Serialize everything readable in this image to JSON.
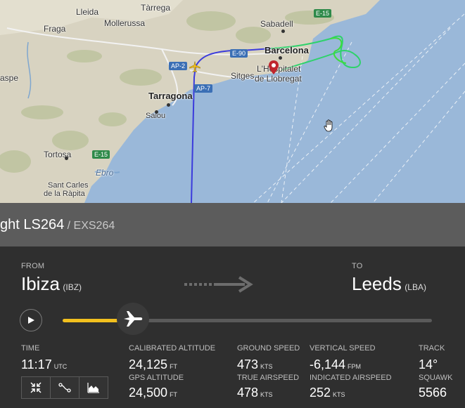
{
  "map": {
    "cities": {
      "lleida": "Lleida",
      "tarrega": "Tàrrega",
      "mollerussa": "Mollerussa",
      "fraga": "Fraga",
      "sabadell": "Sabadell",
      "barcelona": "Barcelona",
      "lhospitalet_1": "L'Hospitalet",
      "lhospitalet_2": "de Llobregat",
      "sitges": "Sitges",
      "tarragona": "Tarragona",
      "salou": "Salou",
      "tortosa": "Tortosa",
      "ebro": "Ebro",
      "santcarles_1": "Sant Carles",
      "santcarles_2": "de la Ràpita",
      "caspe": "aspe"
    },
    "roads": {
      "e15_top": "E-15",
      "e15_left": "E-15",
      "e90": "E-90",
      "ap2": "AP-2",
      "ap7": "AP-7"
    }
  },
  "flight": {
    "title_main": "ght LS264",
    "title_sub": " / EXS264"
  },
  "route": {
    "from_label": "FROM",
    "from_city": "Ibiza",
    "from_code": "(IBZ)",
    "to_label": "TO",
    "to_city": "Leeds",
    "to_code": "(LBA)",
    "progress": 0.19
  },
  "stats": {
    "time_label": "TIME",
    "time_value": "11:17",
    "time_unit": "UTC",
    "cal_alt_label": "CALIBRATED ALTITUDE",
    "cal_alt_value": "24,125",
    "cal_alt_unit": "FT",
    "gps_alt_label": "GPS ALTITUDE",
    "gps_alt_value": "24,500",
    "gps_alt_unit": "FT",
    "gs_label": "GROUND SPEED",
    "gs_value": "473",
    "gs_unit": "KTS",
    "tas_label": "TRUE AIRSPEED",
    "tas_value": "478",
    "tas_unit": "KTS",
    "vs_label": "VERTICAL SPEED",
    "vs_value": "-6,144",
    "vs_unit": "FPM",
    "ias_label": "INDICATED AIRSPEED",
    "ias_value": "252",
    "ias_unit": "KTS",
    "track_label": "TRACK",
    "track_value": "14°",
    "squawk_label": "SQUAWK",
    "squawk_value": "5566"
  },
  "colors": {
    "progress_fill": "#f2c01e",
    "sea": "#9ab8d9",
    "land": "#d9d5c4"
  },
  "icons": [
    "play-icon",
    "plane-icon",
    "arrow-right-icon",
    "collapse-icon",
    "route-icon",
    "chart-icon",
    "pan-cursor-icon"
  ]
}
